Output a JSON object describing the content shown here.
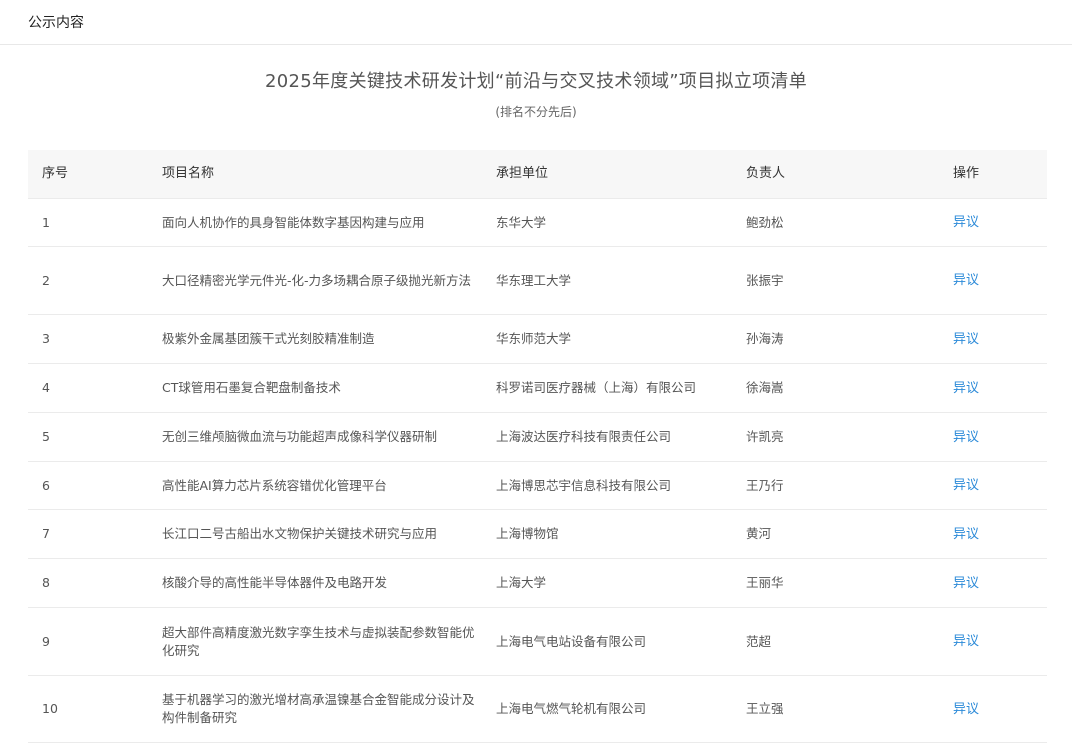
{
  "topbar": {
    "title": "公示内容"
  },
  "notice": {
    "title": "2025年度关键技术研发计划“前沿与交叉技术领域”项目拟立项清单",
    "subtitle": "(排名不分先后)"
  },
  "table": {
    "columns": [
      "序号",
      "项目名称",
      "承担单位",
      "负责人",
      "操作"
    ],
    "rows": [
      {
        "no": "1",
        "name": "面向人机协作的具身智能体数字基因构建与应用",
        "unit": "东华大学",
        "lead": "鲍劲松",
        "action": "异议"
      },
      {
        "no": "2",
        "name": "大口径精密光学元件光-化-力多场耦合原子级抛光新方法",
        "unit": "华东理工大学",
        "lead": "张振宇",
        "action": "异议"
      },
      {
        "no": "3",
        "name": "极紫外金属基团簇干式光刻胶精准制造",
        "unit": "华东师范大学",
        "lead": "孙海涛",
        "action": "异议"
      },
      {
        "no": "4",
        "name": "CT球管用石墨复合靶盘制备技术",
        "unit": "科罗诺司医疗器械（上海）有限公司",
        "lead": "徐海嵩",
        "action": "异议"
      },
      {
        "no": "5",
        "name": "无创三维颅脑微血流与功能超声成像科学仪器研制",
        "unit": "上海波达医疗科技有限责任公司",
        "lead": "许凯亮",
        "action": "异议"
      },
      {
        "no": "6",
        "name": "高性能AI算力芯片系统容错优化管理平台",
        "unit": "上海博思芯宇信息科技有限公司",
        "lead": "王乃行",
        "action": "异议"
      },
      {
        "no": "7",
        "name": "长江口二号古船出水文物保护关键技术研究与应用",
        "unit": "上海博物馆",
        "lead": "黄河",
        "action": "异议"
      },
      {
        "no": "8",
        "name": "核酸介导的高性能半导体器件及电路开发",
        "unit": "上海大学",
        "lead": "王丽华",
        "action": "异议"
      },
      {
        "no": "9",
        "name": "超大部件高精度激光数字孪生技术与虚拟装配参数智能优化研究",
        "unit": "上海电气电站设备有限公司",
        "lead": "范超",
        "action": "异议"
      },
      {
        "no": "10",
        "name": "基于机器学习的激光增材高承温镍基合金智能成分设计及构件制备研究",
        "unit": "上海电气燃气轮机有限公司",
        "lead": "王立强",
        "action": "异议"
      }
    ]
  },
  "colors": {
    "link": "#2b8ad8",
    "header_bg": "#f7f7f7",
    "border": "#ebebeb"
  }
}
